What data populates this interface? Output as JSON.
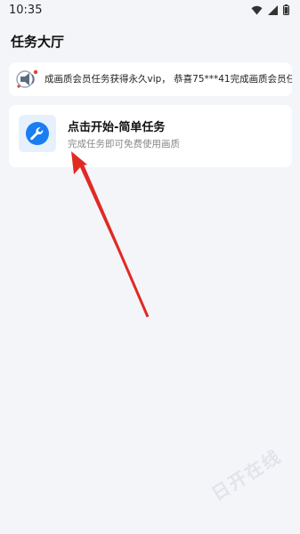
{
  "status_bar": {
    "time": "10:35"
  },
  "page": {
    "title": "任务大厅"
  },
  "marquee": {
    "text": "成画质会员任务获得永久vip， 恭喜75***41完成画质会员任"
  },
  "task": {
    "title": "点击开始-简单任务",
    "description": "完成任务即可免费使用画质",
    "icon": "wrench-icon",
    "icon_color": "#1a7ef2"
  },
  "watermark": {
    "text": "日开在线"
  },
  "colors": {
    "arrow": "#e02a24",
    "background": "#f4f5f9"
  }
}
